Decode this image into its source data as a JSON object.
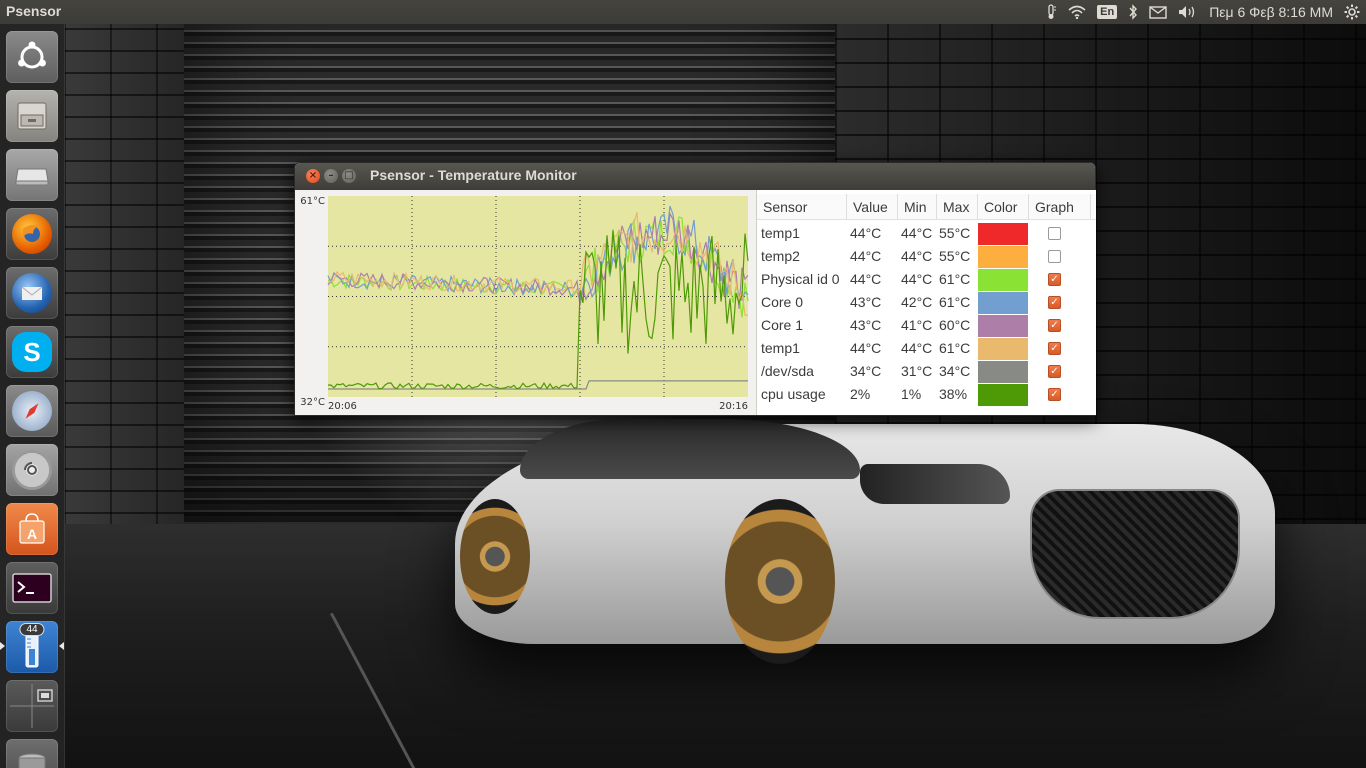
{
  "top_panel": {
    "app_title": "Psensor",
    "keyboard_layout": "En",
    "datetime": "Πεμ  6 Φεβ  8:16 ΜΜ",
    "icons": [
      "thermometer-icon",
      "wifi-icon",
      "keyboard-icon",
      "bluetooth-icon",
      "mail-icon",
      "volume-icon",
      "datetime",
      "gear-icon"
    ]
  },
  "launcher": {
    "items": [
      {
        "name": "dash-home",
        "glyph": "◉"
      },
      {
        "name": "files",
        "glyph": "▭"
      },
      {
        "name": "disk",
        "glyph": "▬"
      },
      {
        "name": "firefox",
        "glyph": "◐"
      },
      {
        "name": "thunderbird",
        "glyph": "✉"
      },
      {
        "name": "skype",
        "glyph": "S"
      },
      {
        "name": "safari",
        "glyph": "✦"
      },
      {
        "name": "disk-utility",
        "glyph": "◎"
      },
      {
        "name": "software-center",
        "glyph": "A"
      },
      {
        "name": "terminal",
        "glyph": ">_"
      },
      {
        "name": "psensor",
        "glyph": "🌡",
        "badge": "44"
      },
      {
        "name": "workspace-switcher",
        "glyph": "▦"
      },
      {
        "name": "trash",
        "glyph": "▯"
      }
    ]
  },
  "window": {
    "title": "Psensor - Temperature Monitor",
    "close_glyph": "×",
    "minimize_glyph": "–",
    "maximize_glyph": "□"
  },
  "graph": {
    "y_max_label": "61°C",
    "y_min_label": "32°C",
    "x_start_label": "20:06",
    "x_end_label": "20:16",
    "background_color": "#e6e6a3"
  },
  "sensor_table": {
    "headers": {
      "sensor": "Sensor",
      "value": "Value",
      "min": "Min",
      "max": "Max",
      "color": "Color",
      "graph": "Graph"
    },
    "rows": [
      {
        "sensor": "temp1",
        "value": "44°C",
        "min": "44°C",
        "max": "55°C",
        "color": "#ef2929",
        "graph": false
      },
      {
        "sensor": "temp2",
        "value": "44°C",
        "min": "44°C",
        "max": "55°C",
        "color": "#fcaf3e",
        "graph": false
      },
      {
        "sensor": "Physical id 0",
        "value": "44°C",
        "min": "44°C",
        "max": "61°C",
        "color": "#8ae234",
        "graph": true
      },
      {
        "sensor": "Core 0",
        "value": "43°C",
        "min": "42°C",
        "max": "61°C",
        "color": "#729fcf",
        "graph": true
      },
      {
        "sensor": "Core 1",
        "value": "43°C",
        "min": "41°C",
        "max": "60°C",
        "color": "#ad7fa8",
        "graph": true
      },
      {
        "sensor": "temp1",
        "value": "44°C",
        "min": "44°C",
        "max": "61°C",
        "color": "#e9b96e",
        "graph": true
      },
      {
        "sensor": "/dev/sda",
        "value": "34°C",
        "min": "31°C",
        "max": "34°C",
        "color": "#888a85",
        "graph": true
      },
      {
        "sensor": "cpu usage",
        "value": "2%",
        "min": "1%",
        "max": "38%",
        "color": "#4e9a06",
        "graph": true
      }
    ]
  }
}
